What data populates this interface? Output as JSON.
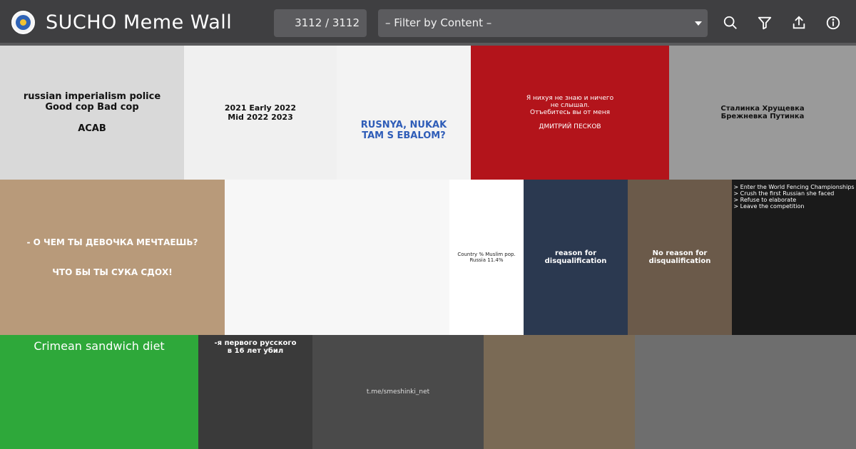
{
  "app": {
    "title": "SUCHO Meme Wall",
    "logo_icon": "sucho-logo-icon"
  },
  "toolbar": {
    "counter": "3112 / 3112",
    "filter_placeholder": "– Filter by Content –",
    "buttons": [
      {
        "name": "search-button",
        "icon": "search-icon"
      },
      {
        "name": "filter-button",
        "icon": "funnel-icon"
      },
      {
        "name": "share-button",
        "icon": "share-upload-icon"
      },
      {
        "name": "info-button",
        "icon": "info-icon"
      }
    ]
  },
  "colors": {
    "header_bg": "#3f3f41",
    "control_bg": "#5b5b5e",
    "text_light": "#ffffff"
  },
  "tiles": [
    {
      "id": "t1",
      "bg": "#d9d9d9",
      "fg": "#111111",
      "caption": "russian imperialism police\nGood cop     Bad cop\n\nACAB"
    },
    {
      "id": "t2",
      "bg": "#f0f0f0",
      "fg": "#111111",
      "caption": "2021     Early 2022\nMid 2022     2023"
    },
    {
      "id": "t3",
      "bg": "#f3f3f3",
      "fg": "#2f5db8",
      "caption": "RUSNYA, NUKAK\nTAM S EBALOM?"
    },
    {
      "id": "t4",
      "bg": "#b3141b",
      "fg": "#ffffff",
      "caption": "Я нихуя не знаю и ничего\nне слышал.\nОтъебитесь вы от меня\n\nДМИТРИЙ ПЕСКОВ"
    },
    {
      "id": "t5",
      "bg": "#9a9a9a",
      "fg": "#111111",
      "caption": "Сталинка     Хрущевка\nБрежневка     Путинка"
    },
    {
      "id": "t6",
      "bg": "#b89a7a",
      "fg": "#ffffff",
      "caption": "- О ЧЕМ ТЫ ДЕВОЧКА МЕЧТАЕШЬ?\n\n\nЧТО БЫ ТЫ СУКА СДОХ!"
    },
    {
      "id": "t7",
      "bg": "#f7f7f7",
      "fg": "#333333",
      "caption": ""
    },
    {
      "id": "t8",
      "bg": "#ffffff",
      "fg": "#222222",
      "caption": "Country     % Muslim pop.\nRussia     11.4%"
    },
    {
      "id": "t9",
      "bg": "#2b3950",
      "fg": "#ffffff",
      "caption": "reason for disqualification"
    },
    {
      "id": "t10",
      "bg": "#6b5a4a",
      "fg": "#ffffff",
      "caption": "No reason for disqualification"
    },
    {
      "id": "t11",
      "bg": "#1a1a1a",
      "fg": "#ffffff",
      "caption": "> Enter the World Fencing Championships\n> Crush the first Russian she faced\n> Refuse to elaborate\n> Leave the competition"
    },
    {
      "id": "t12",
      "bg": "#2ea83a",
      "fg": "#ffffff",
      "caption": "Crimean sandwich diet"
    },
    {
      "id": "t13",
      "bg": "#3a3a3a",
      "fg": "#ffffff",
      "caption": "-я первого русского\nв 16 лет убил"
    },
    {
      "id": "t14",
      "bg": "#4a4a4a",
      "fg": "#dddddd",
      "caption": "t.me/smeshinki_net"
    },
    {
      "id": "t15",
      "bg": "#7a6a55",
      "fg": "#ffffff",
      "caption": ""
    },
    {
      "id": "t16",
      "bg": "#6e6e6e",
      "fg": "#ffffff",
      "caption": ""
    }
  ]
}
